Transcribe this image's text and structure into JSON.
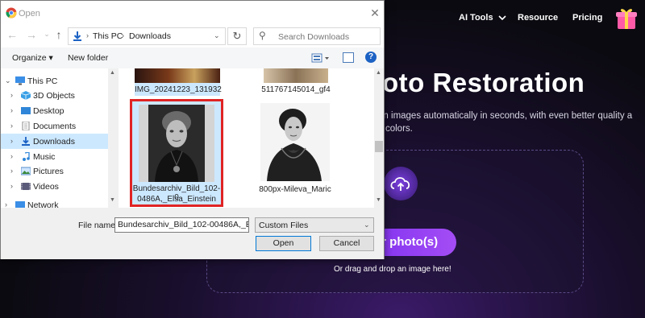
{
  "webpage": {
    "nav": {
      "ai_tools": "AI Tools",
      "resource": "Resource",
      "pricing": "Pricing"
    },
    "hero_title": "oto Restoration",
    "hero_subtitle_line1": "torn images automatically in seconds, with even better quality a",
    "hero_subtitle_line2": "ral colors.",
    "upload_button": "ur photo(s)",
    "drag_text": "Or drag and drop an image here!",
    "accent_color": "#8b3ef0"
  },
  "dialog": {
    "title": "Open",
    "close_glyph": "✕",
    "address": {
      "this_pc": "This PC",
      "downloads": "Downloads"
    },
    "search_placeholder": "Search Downloads",
    "toolbar": {
      "organize": "Organize ▾",
      "new_folder": "New folder",
      "help": "?"
    },
    "nav_items": [
      {
        "label": "This PC",
        "icon": "computer-icon"
      },
      {
        "label": "3D Objects",
        "icon": "cube-icon"
      },
      {
        "label": "Desktop",
        "icon": "desktop-icon"
      },
      {
        "label": "Documents",
        "icon": "document-icon"
      },
      {
        "label": "Downloads",
        "icon": "download-icon",
        "selected": true
      },
      {
        "label": "Music",
        "icon": "music-icon"
      },
      {
        "label": "Pictures",
        "icon": "pictures-icon"
      },
      {
        "label": "Videos",
        "icon": "video-icon"
      },
      {
        "label": "Network",
        "icon": "network-icon"
      }
    ],
    "files": [
      {
        "name": "IMG_20241223_131932"
      },
      {
        "name": "511767145014_gf4"
      },
      {
        "name_line1": "Bundesarchiv_Bild_102-0",
        "name_line2": "0486A,_Elsa_Einstein",
        "selected": true
      },
      {
        "name": "800px-Mileva_Maric"
      }
    ],
    "footer": {
      "file_name_label": "File name:",
      "file_name_value": "Bundesarchiv_Bild_102-00486A,_Elsa",
      "file_type": "Custom Files",
      "open": "Open",
      "cancel": "Cancel"
    }
  }
}
